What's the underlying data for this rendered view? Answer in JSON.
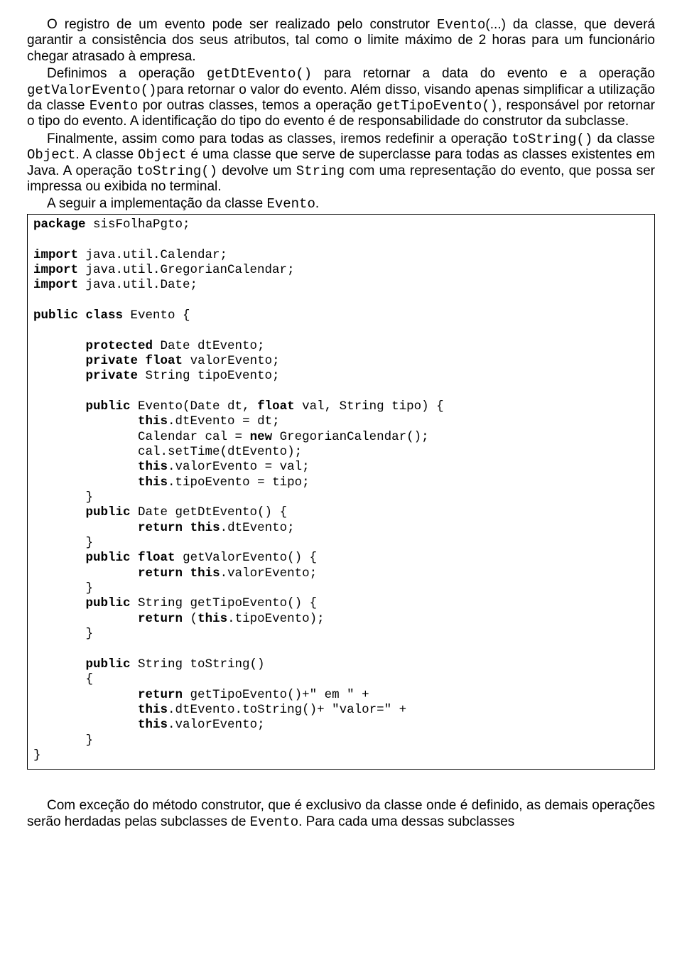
{
  "paragraphs": {
    "p1_a": "O registro de um evento pode ser realizado pelo construtor ",
    "p1_code1": "Evento",
    "p1_b": "(...) da classe, que deverá garantir a consistência dos seus atributos, tal como o limite máximo de 2 horas para um funcionário chegar atrasado à empresa.",
    "p2_a": "Definimos a operação ",
    "p2_code1": "getDtEvento()",
    "p2_b": " para retornar a data do evento e a operação ",
    "p2_code2": "getValorEvento()",
    "p2_c": "para retornar o valor do evento. Além disso, visando apenas simplificar a utilização da classe ",
    "p2_code3": "Evento",
    "p2_d": " por outras classes, temos a operação ",
    "p2_code4": "getTipoEvento()",
    "p2_e": ", responsável por retornar o tipo do evento. A identificação do tipo do evento é de responsabilidade do construtor da subclasse.",
    "p3_a": "Finalmente, assim como para todas as classes, iremos redefinir a operação ",
    "p3_code1": "toString()",
    "p3_b": " da classe ",
    "p3_code2": "Object",
    "p3_c": ". A classe ",
    "p3_code3": "Object",
    "p3_d": " é uma classe que serve de superclasse para todas as classes existentes em Java. A operação ",
    "p3_code4": "toString()",
    "p3_e": " devolve um ",
    "p3_code5": "String",
    "p3_f": " com uma representação do evento, que possa ser impressa ou exibida no terminal.",
    "p4_a": "A seguir a implementação da classe ",
    "p4_code1": "Evento",
    "p4_b": "."
  },
  "code": {
    "l01_kw": "package",
    "l01_rest": " sisFolhaPgto;",
    "blank1": "",
    "l02_kw": "import",
    "l02_rest": " java.util.Calendar;",
    "l03_kw": "import",
    "l03_rest": " java.util.GregorianCalendar;",
    "l04_kw": "import",
    "l04_rest": " java.util.Date;",
    "blank2": "",
    "l05_kw1": "public",
    "l05_sp1": " ",
    "l05_kw2": "class",
    "l05_rest": " Evento {",
    "blank3": "",
    "l06_pad": "       ",
    "l06_kw": "protected",
    "l06_rest": " Date dtEvento;",
    "l07_pad": "       ",
    "l07_kw1": "private",
    "l07_sp": " ",
    "l07_kw2": "float",
    "l07_rest": " valorEvento;",
    "l08_pad": "       ",
    "l08_kw": "private",
    "l08_rest": " String tipoEvento;",
    "blank4": "",
    "l09_pad": "       ",
    "l09_kw1": "public",
    "l09_mid": " Evento(Date dt, ",
    "l09_kw2": "float",
    "l09_rest": " val, String tipo) {",
    "l10_pad": "              ",
    "l10_kw": "this",
    "l10_rest": ".dtEvento = dt;",
    "l11_pad": "              ",
    "l11_a": "Calendar cal = ",
    "l11_kw": "new",
    "l11_rest": " GregorianCalendar();",
    "l12_pad": "              ",
    "l12_rest": "cal.setTime(dtEvento);",
    "l13_pad": "              ",
    "l13_kw": "this",
    "l13_rest": ".valorEvento = val;",
    "l14_pad": "              ",
    "l14_kw": "this",
    "l14_rest": ".tipoEvento = tipo;",
    "l15_pad": "       ",
    "l15_rest": "}",
    "l16_pad": "       ",
    "l16_kw": "public",
    "l16_rest": " Date getDtEvento() {",
    "l17_pad": "              ",
    "l17_kw1": "return",
    "l17_sp": " ",
    "l17_kw2": "this",
    "l17_rest": ".dtEvento;",
    "l18_pad": "       ",
    "l18_rest": "}",
    "l19_pad": "       ",
    "l19_kw1": "public",
    "l19_sp": " ",
    "l19_kw2": "float",
    "l19_rest": " getValorEvento() {",
    "l20_pad": "              ",
    "l20_kw1": "return",
    "l20_sp": " ",
    "l20_kw2": "this",
    "l20_rest": ".valorEvento;",
    "l21_pad": "       ",
    "l21_rest": "}",
    "l22_pad": "       ",
    "l22_kw": "public",
    "l22_rest": " String getTipoEvento() {",
    "l23_pad": "              ",
    "l23_kw1": "return",
    "l23_mid": " (",
    "l23_kw2": "this",
    "l23_rest": ".tipoEvento);",
    "l24_pad": "       ",
    "l24_rest": "}",
    "blank5": "",
    "l25_pad": "       ",
    "l25_kw": "public",
    "l25_rest": " String toString()",
    "l26_pad": "       ",
    "l26_rest": "{",
    "l27_pad": "              ",
    "l27_kw": "return",
    "l27_rest": " getTipoEvento()+\" em \" +",
    "l28_pad": "              ",
    "l28_kw": "this",
    "l28_rest": ".dtEvento.toString()+ \"valor=\" +",
    "l29_pad": "              ",
    "l29_kw": "this",
    "l29_rest": ".valorEvento;",
    "l30_pad": "       ",
    "l30_rest": "}",
    "l31_rest": "}"
  },
  "after": {
    "p5_a": "Com exceção do método construtor, que é exclusivo da classe onde é definido, as demais operações serão herdadas pelas subclasses de ",
    "p5_code1": "Evento",
    "p5_b": ". Para cada uma dessas subclasses"
  }
}
